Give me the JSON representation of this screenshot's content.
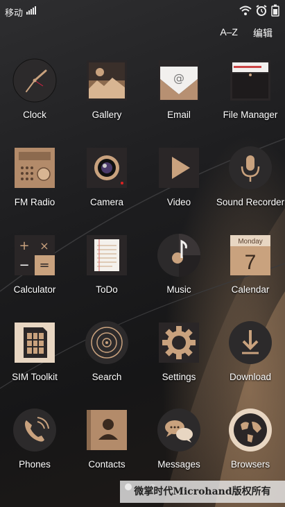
{
  "status_bar": {
    "carrier": "移动",
    "icons": [
      "signal-icon",
      "wifi-icon",
      "alarm-icon",
      "battery-icon"
    ]
  },
  "top_bar": {
    "sort_label": "A–Z",
    "edit_label": "编辑"
  },
  "apps": [
    {
      "label": "Clock",
      "icon": "clock-icon"
    },
    {
      "label": "Gallery",
      "icon": "gallery-icon"
    },
    {
      "label": "Email",
      "icon": "email-icon"
    },
    {
      "label": "File Manager",
      "icon": "file-manager-icon"
    },
    {
      "label": "FM Radio",
      "icon": "radio-icon"
    },
    {
      "label": "Camera",
      "icon": "camera-icon"
    },
    {
      "label": "Video",
      "icon": "video-icon"
    },
    {
      "label": "Sound Recorder",
      "icon": "microphone-icon"
    },
    {
      "label": "Calculator",
      "icon": "calculator-icon"
    },
    {
      "label": "ToDo",
      "icon": "notepad-icon"
    },
    {
      "label": "Music",
      "icon": "music-icon"
    },
    {
      "label": "Calendar",
      "icon": "calendar-icon",
      "day_name": "Monday",
      "day_number": "7"
    },
    {
      "label": "SIM Toolkit",
      "icon": "sim-card-icon"
    },
    {
      "label": "Search",
      "icon": "search-icon"
    },
    {
      "label": "Settings",
      "icon": "gear-icon"
    },
    {
      "label": "Download",
      "icon": "download-icon"
    },
    {
      "label": "Phones",
      "icon": "phone-icon"
    },
    {
      "label": "Contacts",
      "icon": "contacts-icon"
    },
    {
      "label": "Messages",
      "icon": "messages-icon"
    },
    {
      "label": "Browsers",
      "icon": "globe-icon"
    }
  ],
  "page_indicator": {
    "pages": 2,
    "current": 1
  },
  "watermark": "微掌时代Microhand版权所有",
  "colors": {
    "copper": "#c9a27e",
    "copper_dark": "#8c6a4e",
    "tile_dark": "#2a2627"
  }
}
